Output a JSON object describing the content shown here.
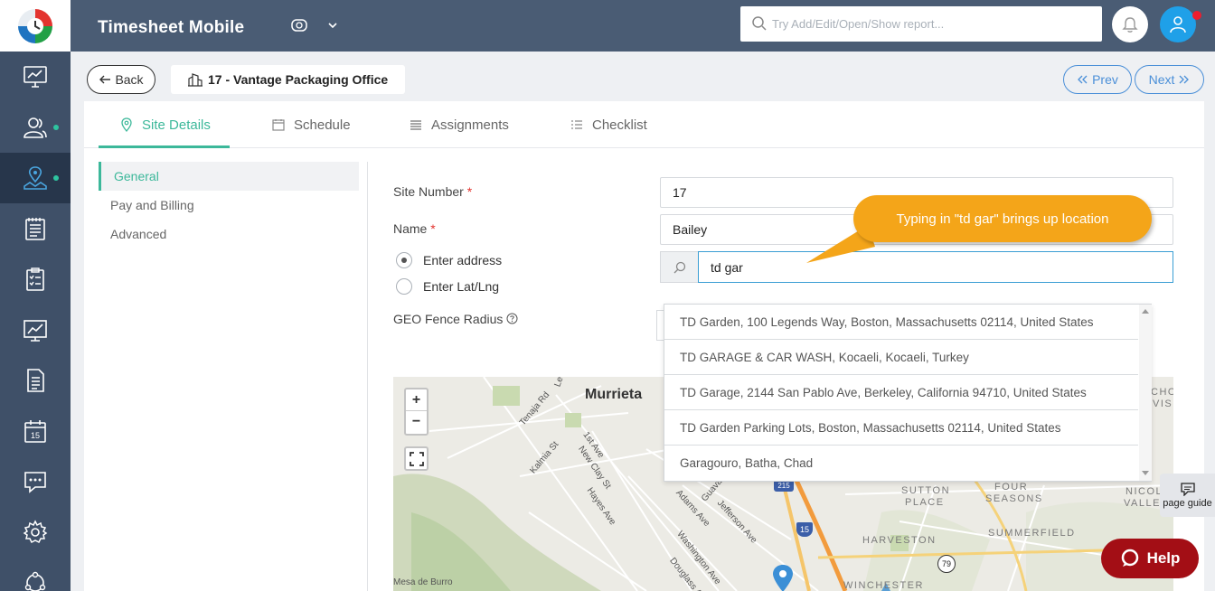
{
  "app": {
    "title": "Timesheet Mobile"
  },
  "topbar": {
    "search_placeholder": "Try Add/Edit/Open/Show report..."
  },
  "header": {
    "back_label": "Back",
    "site_title": "17 - Vantage Packaging Office",
    "prev_label": "Prev",
    "next_label": "Next"
  },
  "tabs": [
    {
      "label": "Site Details",
      "icon": "map-pin-icon",
      "active": true
    },
    {
      "label": "Schedule",
      "icon": "calendar-icon"
    },
    {
      "label": "Assignments",
      "icon": "list-icon"
    },
    {
      "label": "Checklist",
      "icon": "checklist-icon"
    }
  ],
  "left_nav": [
    {
      "label": "General",
      "active": true
    },
    {
      "label": "Pay and Billing"
    },
    {
      "label": "Advanced"
    }
  ],
  "form": {
    "site_number_label": "Site Number",
    "site_number_value": "17",
    "name_label": "Name",
    "name_value": "Bailey",
    "radio_address": "Enter address",
    "radio_latlng": "Enter Lat/Lng",
    "address_value": "td gar",
    "geo_fence_label": "GEO Fence Radius",
    "required_mark": "*"
  },
  "suggestions": [
    "TD Garden, 100 Legends Way, Boston, Massachusetts 02114, United States",
    "TD GARAGE & CAR WASH, Kocaeli, Kocaeli, Turkey",
    "TD Garage, 2144 San Pablo Ave, Berkeley, California 94710, United States",
    "TD Garden Parking Lots, Boston, Massachusetts 02114, United States",
    "Garagouro, Batha, Chad"
  ],
  "callout": {
    "text": "Typing in \"td gar\" brings up  location"
  },
  "map": {
    "zoom_in": "+",
    "zoom_out": "−",
    "city": "Murrieta",
    "labels": {
      "tenaja": "Tenaja Rd",
      "kalmia": "Kalmia St",
      "first_ave": "1st Ave",
      "new_clay": "New Clay St",
      "hayes": "Hayes Ave",
      "adams": "Adams Ave",
      "guava": "Guava",
      "jefferson": "Jefferson Ave",
      "washington": "Washington Ave",
      "douglass": "Douglass Av",
      "mesa": "Mesa de Burro",
      "le": "Le",
      "sutton": "SUTTON",
      "place": "PLACE",
      "four": "FOUR",
      "seasons": "SEASONS",
      "nicolas": "NICOLAS",
      "valley": "VALLE",
      "harveston": "HARVESTON",
      "summerfield": "SUMMERFIELD",
      "winchester": "WINCHESTER",
      "cho": "CHO",
      "vis": "VIS",
      "hwy_215": "215",
      "hwy_15": "15",
      "hwy_79": "79"
    }
  },
  "page_guide": "page guide",
  "help_label": "Help",
  "colors": {
    "accent": "#3cb89a",
    "topbar": "#4a5c74",
    "sidebar": "#3f5068",
    "callout": "#f4a519",
    "help": "#a30e15"
  }
}
